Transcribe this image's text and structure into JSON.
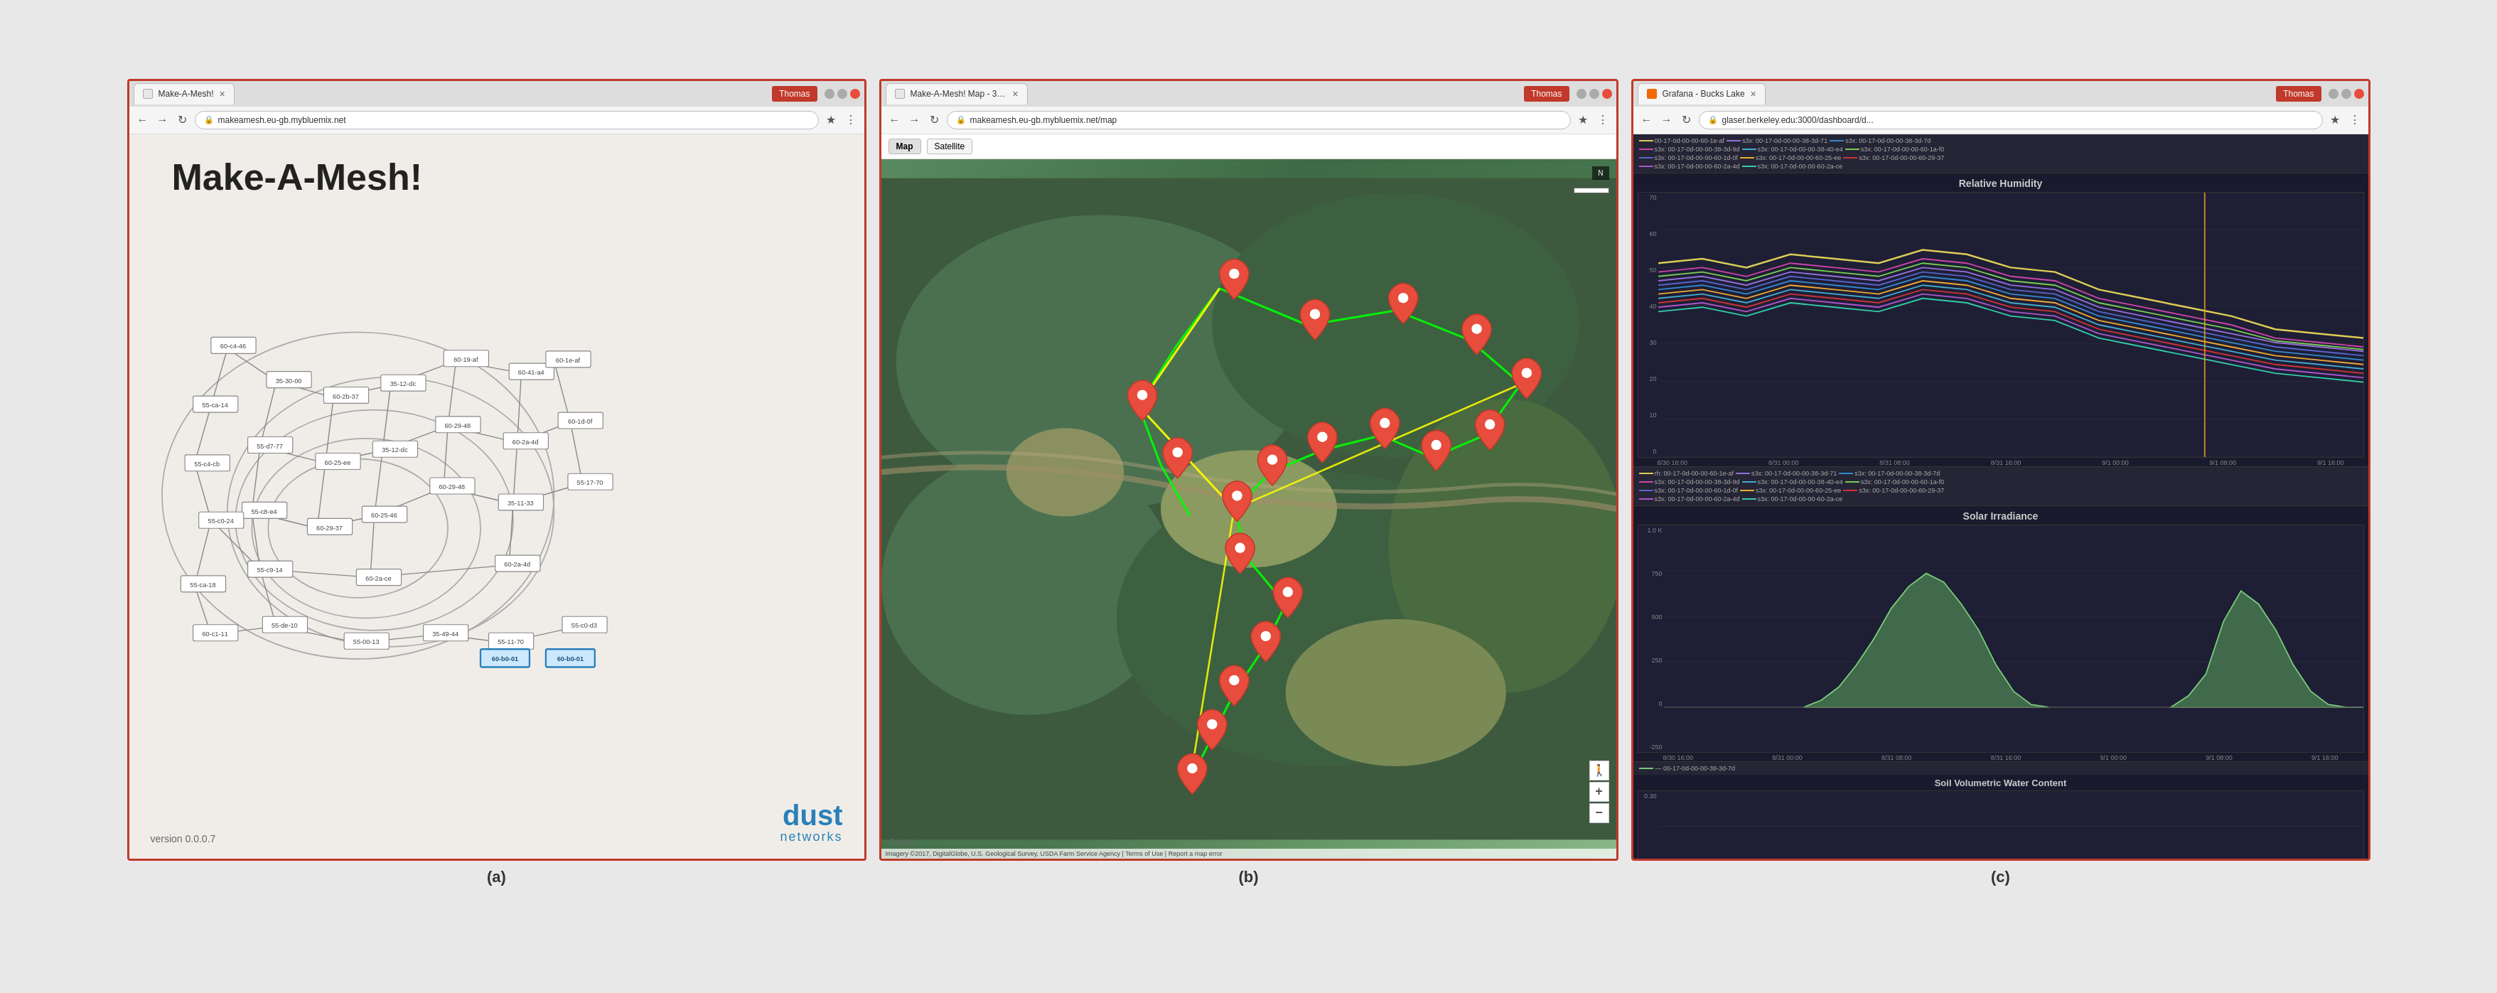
{
  "panels": {
    "a": {
      "tab_title": "Make-A-Mesh!",
      "user": "Thomas",
      "url": "makeamesh.eu-gb.mybluemix.net",
      "title": "Make-A-Mesh!",
      "version": "version 0.0.0.7",
      "logo_main": "dust",
      "logo_sub": "networks",
      "caption": "(a)"
    },
    "b": {
      "tab_title": "Make-A-Mesh! Map - 3D...",
      "user": "Thomas",
      "url": "makeamesh.eu-gb.mybluemix.net/map",
      "map_btn_map": "Map",
      "map_btn_satellite": "Satellite",
      "attribution": "Imagery ©2017, DigitalGlobe, U.S. Geological Survey, USDA Farm Service Agency | Terms of Use | Report a map error",
      "caption": "(b)"
    },
    "c": {
      "tab_title": "Grafana - Bucks Lake",
      "user": "Thomas",
      "url": "glaser.berkeley.edu:3000/dashboard/d...",
      "chart1_title": "Relative Humidity",
      "chart2_title": "Solar Irradiance",
      "chart3_title": "Soil Volumetric Water Content",
      "caption": "(c)",
      "y_axis_humidity": [
        "70",
        "60",
        "50",
        "40",
        "30",
        "20",
        "10",
        "0"
      ],
      "y_axis_solar": [
        "1.0 K",
        "750",
        "500",
        "250",
        "0",
        "-250"
      ],
      "legend_items": [
        {
          "color": "#ddcc55",
          "label": "rh: 00-17-0d-00-00-60-1e-af"
        },
        {
          "color": "#9370db",
          "label": "s3x: 00-17-0d-00-00-38-3d-71"
        },
        {
          "color": "#3388cc",
          "label": "s3x: 00-17-0d-00-00-38-3d-7d"
        },
        {
          "color": "#cc44aa",
          "label": "s3x: 00-17-0d-00-00-38-3d-9d"
        },
        {
          "color": "#44aacc",
          "label": "s3x: 00-17-0d-00-00-38-40-e4"
        },
        {
          "color": "#77cc55",
          "label": "s3x: 00-17-0d-00-00-60-1a-f0"
        },
        {
          "color": "#5566cc",
          "label": "s3x: 00-17-0d-00-00-60-1d-0f"
        },
        {
          "color": "#eeaa33",
          "label": "s3x: 00-17-0d-00-00-60-25-ee"
        },
        {
          "color": "#cc3333",
          "label": "s3x: 00-17-0d-00-00-60-29-37"
        },
        {
          "color": "#aa55cc",
          "label": "s3x: 00-17-0d-00-00-60-2a-4d"
        },
        {
          "color": "#33ccaa",
          "label": "s3x: 00-17-0d-00-00-60-2a-ce"
        }
      ],
      "x_labels_humidity": [
        "8/30 16:00",
        "8/31 00:00",
        "8/31 08:00",
        "8/31 16:00",
        "9/1 00:00",
        "9/1 08:00",
        "9/1 16:00"
      ],
      "x_labels_solar": [
        "8/30 16:00",
        "8/31 00:00",
        "8/31 08:00",
        "8/31 16:00",
        "9/1 00:00",
        "9/1 08:00",
        "9/1 16:00"
      ],
      "solar_legend": "— 00-17-0d-00-00-38-3d-7d",
      "soil_y_label": "0.30"
    }
  }
}
